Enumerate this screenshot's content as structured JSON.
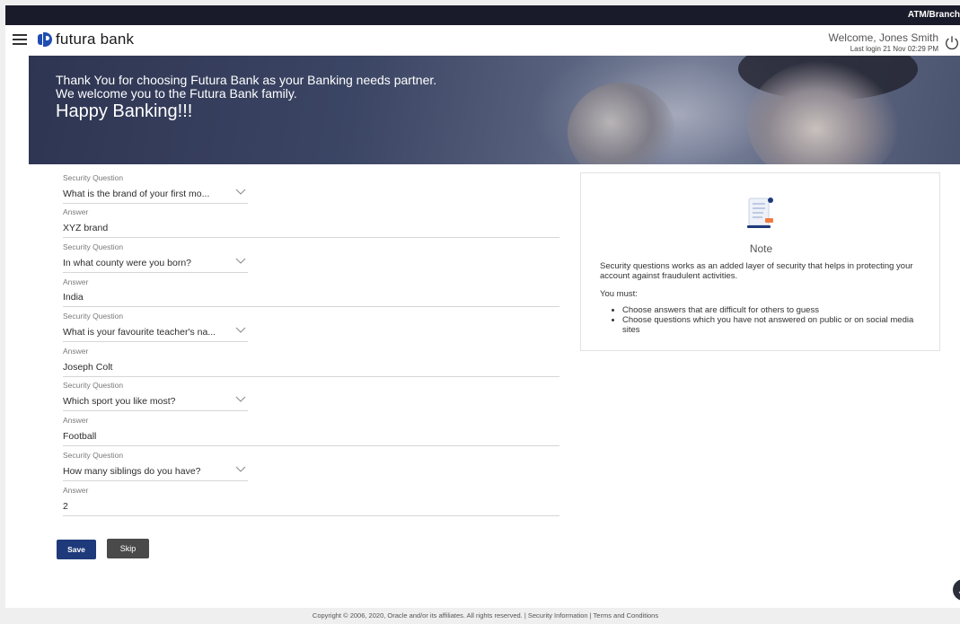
{
  "topbar": {
    "tag": "ATM/Branch"
  },
  "header": {
    "brand": "futura bank",
    "welcome": "Welcome, Jones Smith",
    "last_login": "Last login 21 Nov 02:29 PM"
  },
  "banner": {
    "line1": "Thank You for choosing Futura Bank as your Banking needs partner.",
    "line2": "We welcome you to the Futura Bank family.",
    "line3": "Happy Banking!!!"
  },
  "form": {
    "question_label": "Security Question",
    "answer_label": "Answer",
    "items": [
      {
        "question": "What is the brand of your first mo...",
        "answer": "XYZ brand"
      },
      {
        "question": "In what county were you born?",
        "answer": "India"
      },
      {
        "question": "What is your favourite teacher's na...",
        "answer": "Joseph Colt"
      },
      {
        "question": "Which sport you like most?",
        "answer": "Football"
      },
      {
        "question": "How many siblings do you have?",
        "answer": "2"
      }
    ],
    "save_label": "Save",
    "skip_label": "Skip"
  },
  "note": {
    "title": "Note",
    "body": "Security questions works as an added layer of security that helps in protecting your account against fraudulent activities.",
    "must": "You must:",
    "bullets": [
      "Choose answers that are difficult for others to guess",
      "Choose questions which you have not answered on public or on social media sites"
    ]
  },
  "footer": {
    "text": "Copyright © 2006, 2020, Oracle and/or its affiliates. All rights reserved. | Security Information | Terms and Conditions"
  },
  "colors": {
    "primary": "#1f3a7a",
    "topbar": "#1a1b2a",
    "secondary_button": "#4a4a4a"
  }
}
